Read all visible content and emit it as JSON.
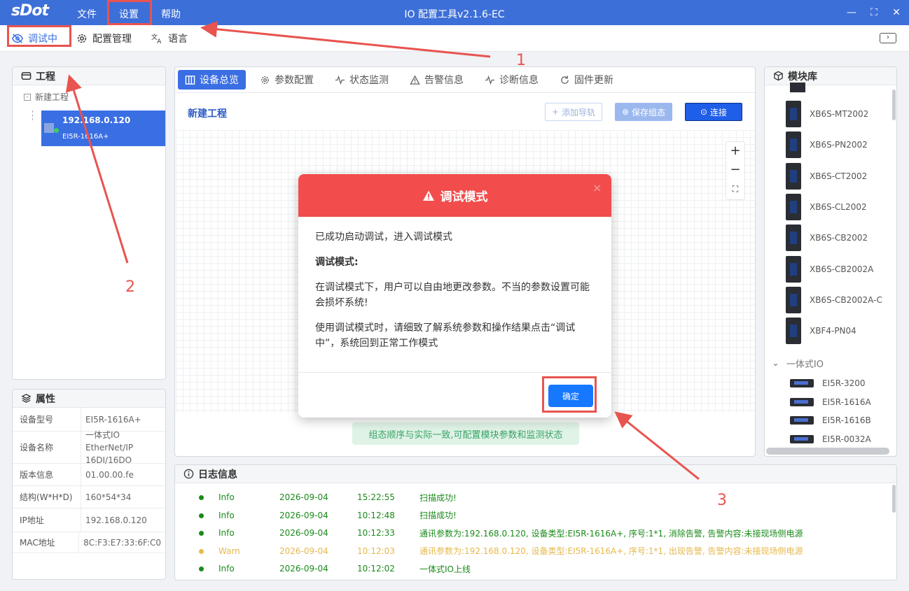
{
  "app": {
    "logo": "sDot",
    "title": "IO 配置工具v2.1.6-EC"
  },
  "menu": {
    "file": "文件",
    "settings": "设置",
    "help": "帮助"
  },
  "window": {
    "minimize": "—",
    "maximize": "⛶",
    "close": "✕"
  },
  "toolbar": {
    "debug": "调试中",
    "config_mgmt": "配置管理",
    "language": "语言"
  },
  "project_panel": {
    "title": "工程",
    "root": "新建工程",
    "device": {
      "ip": "192.168.0.120",
      "model": "EI5R-1616A+"
    }
  },
  "props_panel": {
    "title": "属性",
    "rows": [
      {
        "k": "设备型号",
        "v": "EI5R-1616A+"
      },
      {
        "k": "设备名称",
        "v": "一体式IO EtherNet/IP 16DI/16DO"
      },
      {
        "k": "版本信息",
        "v": "01.00.00.fe"
      },
      {
        "k": "结构(W*H*D)",
        "v": "160*54*34"
      },
      {
        "k": "IP地址",
        "v": "192.168.0.120"
      },
      {
        "k": "MAC地址",
        "v": "8C:F3:E7:33:6F:C0"
      }
    ]
  },
  "tabs": [
    "设备总览",
    "参数配置",
    "状态监测",
    "告警信息",
    "诊断信息",
    "固件更新"
  ],
  "main": {
    "project_name": "新建工程",
    "add_rail": "添加导轨",
    "save_config": "保存组态",
    "connect": "连接",
    "zoom_in": "+",
    "zoom_out": "−",
    "status_msg": "组态顺序与实际一致,可配置模块参数和监测状态"
  },
  "module_lib": {
    "title": "模块库",
    "modules": [
      "XB6S-MT2002",
      "XB6S-PN2002",
      "XB6S-CT2002",
      "XB6S-CL2002",
      "XB6S-CB2002",
      "XB6S-CB2002A",
      "XB6S-CB2002A-C",
      "XBF4-PN04"
    ],
    "group": "一体式IO",
    "group_items": [
      "EI5R-3200",
      "EI5R-1616A",
      "EI5R-1616B",
      "EI5R-0032A"
    ]
  },
  "log": {
    "title": "日志信息",
    "rows": [
      {
        "level": "Info",
        "date": "2026-09-04",
        "time": "15:22:55",
        "msg": "扫描成功!"
      },
      {
        "level": "Info",
        "date": "2026-09-04",
        "time": "10:12:48",
        "msg": "扫描成功!"
      },
      {
        "level": "Info",
        "date": "2026-09-04",
        "time": "10:12:33",
        "msg": "通讯参数为:192.168.0.120, 设备类型:EI5R-1616A+, 序号:1*1, 消除告警, 告警内容:未接现场侧电源"
      },
      {
        "level": "Warn",
        "date": "2026-09-04",
        "time": "10:12:03",
        "msg": "通讯参数为:192.168.0.120, 设备类型:EI5R-1616A+, 序号:1*1, 出现告警, 告警内容:未接现场侧电源"
      },
      {
        "level": "Info",
        "date": "2026-09-04",
        "time": "10:12:02",
        "msg": "一体式IO上线"
      }
    ]
  },
  "dialog": {
    "title": "调试模式",
    "line1": "已成功启动调试，进入调试模式",
    "heading": "调试模式:",
    "para1": "在调试模式下，用户可以自由地更改参数。不当的参数设置可能会损坏系统!",
    "para2": "使用调试模式时，请细致了解系统参数和操作结果点击“调试中”，系统回到正常工作模式",
    "ok": "确定",
    "close": "×"
  },
  "annotations": [
    "1",
    "2",
    "3"
  ],
  "colors": {
    "titlebar": "#3d6fd9",
    "primary": "#3a6ee3",
    "danger": "#f24c4c",
    "info": "#1a8a1a",
    "warn": "#e6b84c",
    "annotation": "#e8544f"
  }
}
